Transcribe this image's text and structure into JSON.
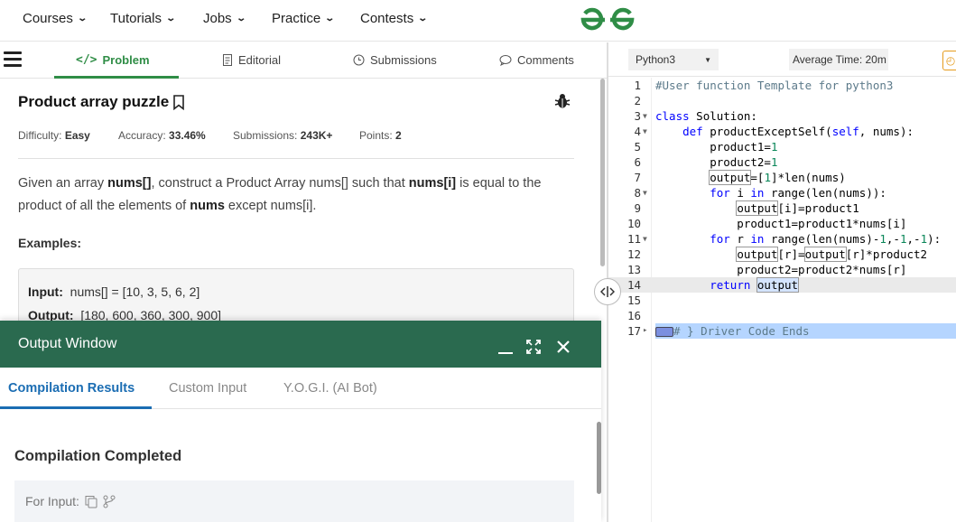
{
  "nav": {
    "items": [
      "Courses",
      "Tutorials",
      "Jobs",
      "Practice",
      "Contests"
    ]
  },
  "tabs": {
    "problem": "Problem",
    "editorial": "Editorial",
    "submissions": "Submissions",
    "comments": "Comments"
  },
  "problem": {
    "title": "Product array puzzle",
    "difficulty_label": "Difficulty:",
    "difficulty": "Easy",
    "accuracy_label": "Accuracy:",
    "accuracy": "33.46%",
    "submissions_label": "Submissions:",
    "submissions": "243K+",
    "points_label": "Points:",
    "points": "2",
    "desc_p1": "Given an array ",
    "desc_b1": "nums[]",
    "desc_p2": ", construct a Product Array nums[] such that ",
    "desc_b2": "nums[i]",
    "desc_p3": " is equal to the product of all the elements of ",
    "desc_b3": "nums",
    "desc_p4": " except nums[i].",
    "examples_label": "Examples:",
    "ex_input_label": "Input:",
    "ex_input": "nums[] = [10, 3, 5, 6, 2]",
    "ex_output_label": "Output:",
    "ex_output": "[180, 600, 360, 300, 900]"
  },
  "output_window": {
    "title": "Output Window",
    "tabs": [
      "Compilation Results",
      "Custom Input",
      "Y.O.G.I. (AI Bot)"
    ],
    "status": "Compilation Completed",
    "for_input": "For Input:"
  },
  "editor": {
    "language": "Python3",
    "avg_time": "Average Time: 20m",
    "lines": [
      "1",
      "2",
      "3",
      "4",
      "5",
      "6",
      "7",
      "8",
      "9",
      "10",
      "11",
      "12",
      "13",
      "14",
      "15",
      "16",
      "17"
    ]
  },
  "colors": {
    "brand_green": "#2f8d46",
    "output_header": "#2a6a4f",
    "active_blue": "#1b6db3"
  }
}
